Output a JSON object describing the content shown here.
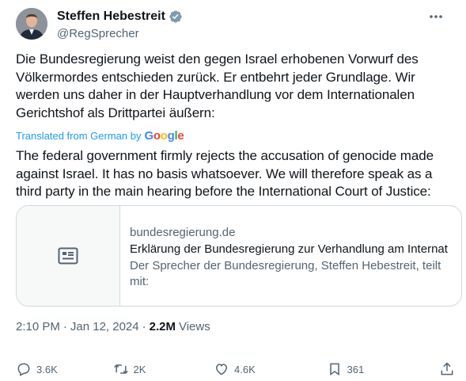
{
  "author": {
    "display_name": "Steffen Hebestreit",
    "handle": "@RegSprecher",
    "verified_icon": "verified-badge-icon"
  },
  "post": {
    "text": "Die Bundesregierung weist den gegen Israel erhobenen Vorwurf des Völkermordes entschieden zurück. Er entbehrt jeder Grundlage. Wir werden uns daher in der Hauptverhandlung vor dem Internationalen Gerichtshof als Drittpartei äußern:",
    "translated_label": "Translated from German by",
    "translated_brand": "Google",
    "translation": "The federal government firmly rejects the accusation of genocide made against Israel. It has no basis whatsoever. We will therefore speak as a third party in the main hearing before the International Court of Justice:"
  },
  "card": {
    "domain": "bundesregierung.de",
    "title": "Erklärung der Bundesregierung zur Verhandlung am Internat",
    "description": "Der Sprecher der Bundesregierung, Steffen Hebestreit, teilt mit:"
  },
  "meta": {
    "time": "2:10 PM",
    "sep1": "·",
    "date": "Jan 12, 2024",
    "sep2": "·",
    "views_count": "2.2M",
    "views_label": "Views"
  },
  "actions": {
    "replies": "3.6K",
    "reposts": "2K",
    "likes": "4.6K",
    "bookmarks": "361"
  },
  "colors": {
    "text": "#0f1419",
    "secondary": "#536471",
    "link": "#1d9bf0",
    "border": "#cfd9de",
    "verified": "#829aab"
  }
}
